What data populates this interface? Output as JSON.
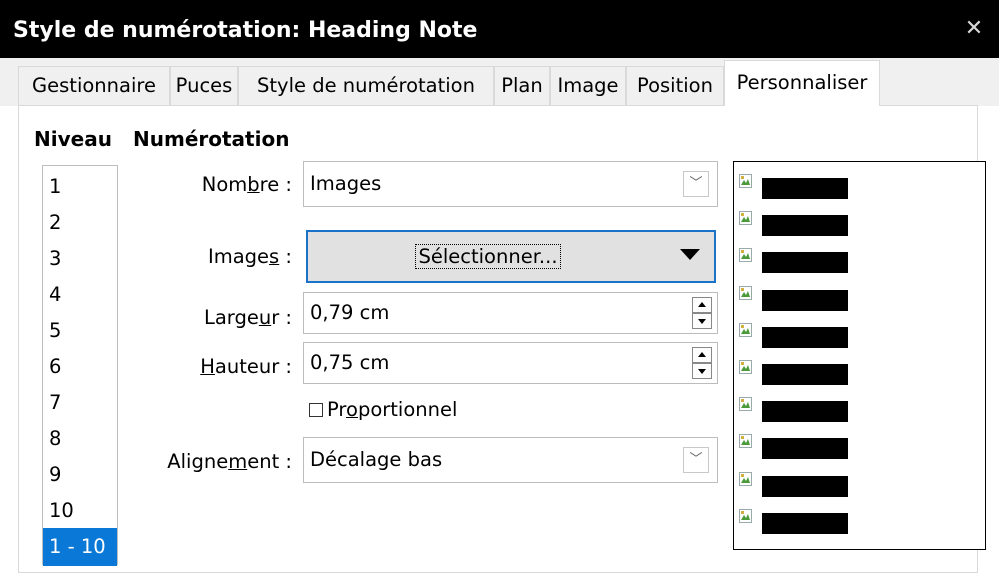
{
  "window": {
    "title": "Style de numérotation: Heading Note",
    "close_glyph": "✕"
  },
  "tabs": [
    {
      "label": "Gestionnaire"
    },
    {
      "label": "Puces"
    },
    {
      "label": "Style de numérotation"
    },
    {
      "label": "Plan"
    },
    {
      "label": "Image"
    },
    {
      "label": "Position"
    },
    {
      "label": "Personnaliser",
      "active": true
    }
  ],
  "level_panel": {
    "header": "Niveau",
    "items": [
      "1",
      "2",
      "3",
      "4",
      "5",
      "6",
      "7",
      "8",
      "9",
      "10",
      "1 - 10"
    ],
    "selected": "1 - 10"
  },
  "numbering": {
    "header": "Numérotation",
    "nombre": {
      "label_pre": "Nom",
      "label_u": "b",
      "label_post": "re :",
      "value": "Images"
    },
    "images": {
      "label_pre": "Image",
      "label_u": "s",
      "label_post": " :",
      "button": "Sélectionner..."
    },
    "largeur": {
      "label_pre": "Large",
      "label_u": "u",
      "label_post": "r :",
      "value": "0,79 cm"
    },
    "hauteur": {
      "label_pre": "",
      "label_u": "H",
      "label_post": "auteur :",
      "value": "0,75 cm"
    },
    "proportionnel": {
      "label_pre": "Pr",
      "label_u": "o",
      "label_post": "portionnel",
      "checked": false
    },
    "alignement": {
      "label_pre": "Aligne",
      "label_u": "m",
      "label_post": "ent :",
      "value": "Décalage bas"
    }
  },
  "preview": {
    "rows": 10,
    "icon": "image-bullet-icon",
    "bar_color": "#000000"
  },
  "colors": {
    "titlebar": "#000000",
    "selection": "#0a78d7",
    "focus_border": "#1b73c9"
  }
}
